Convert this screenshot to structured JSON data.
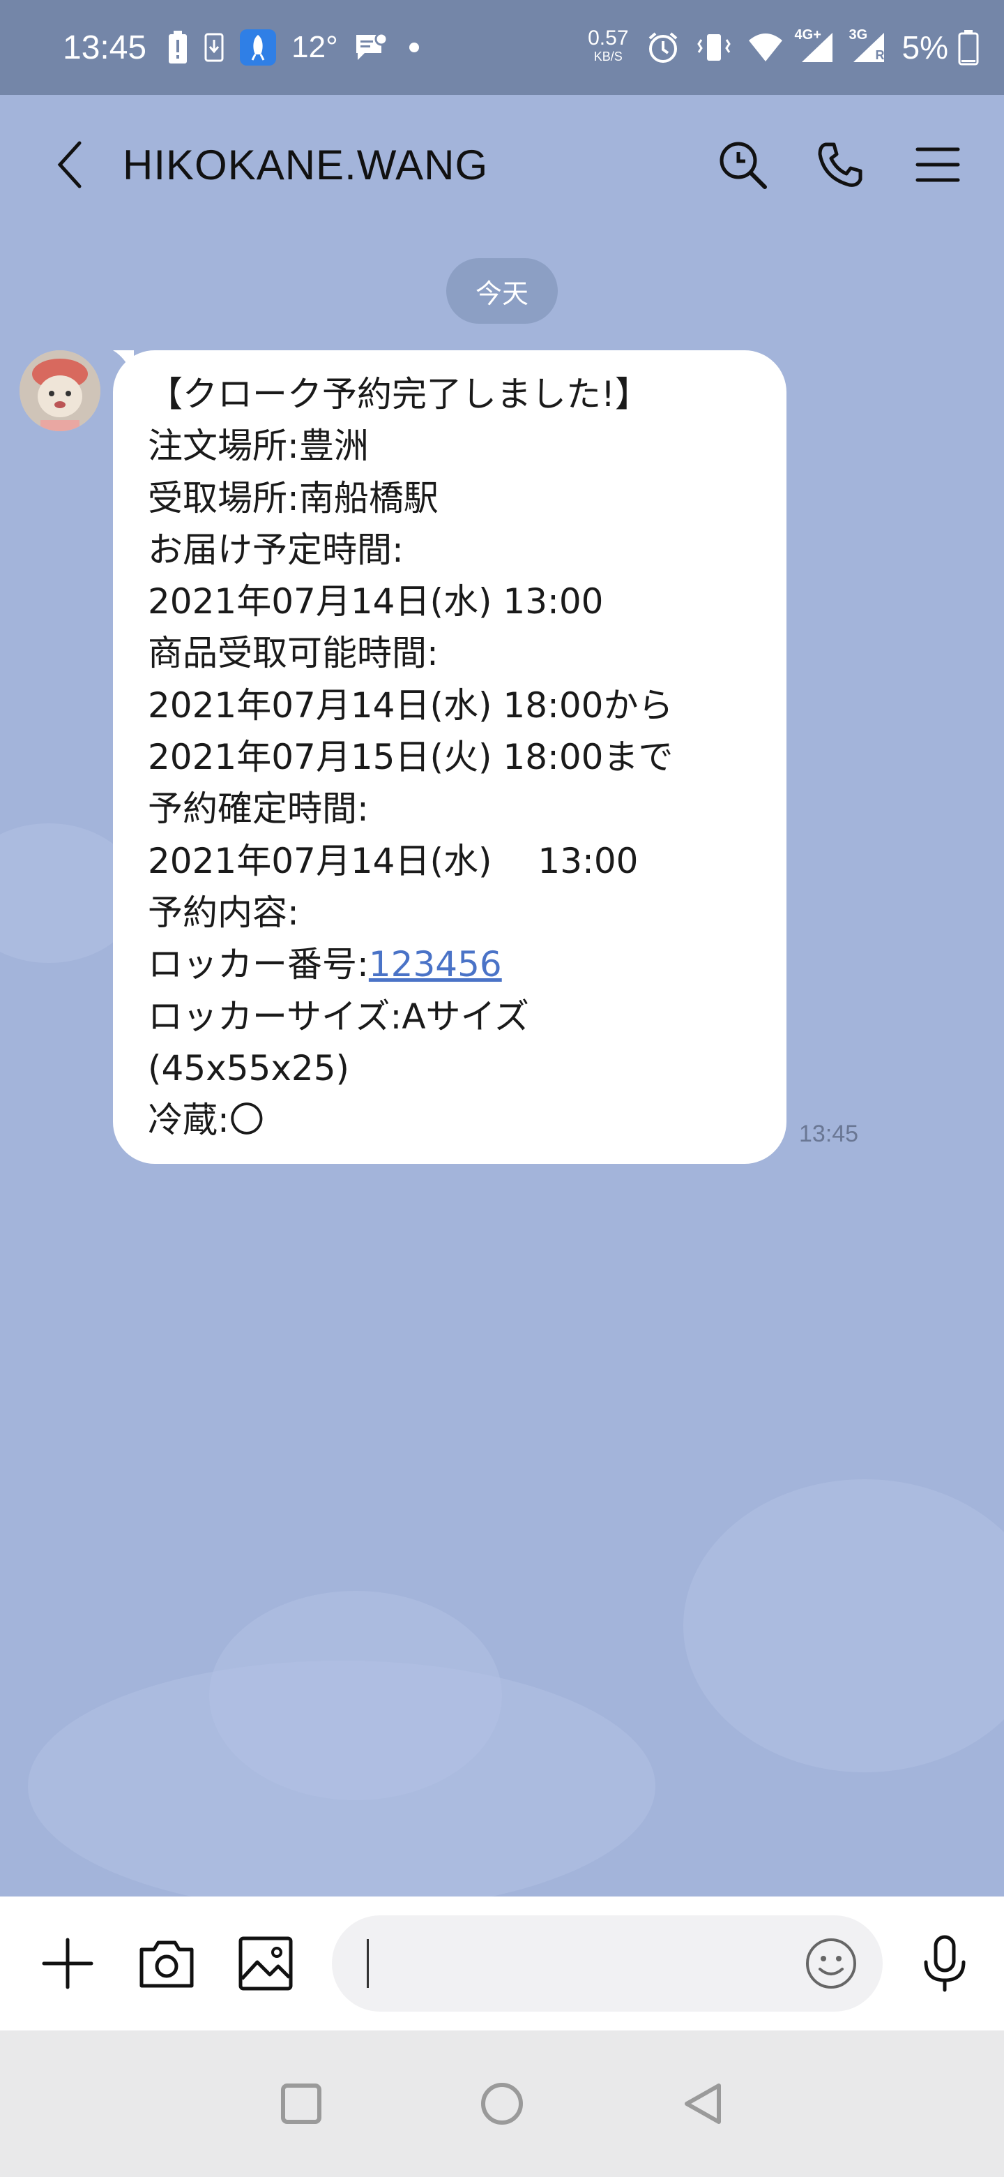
{
  "status_bar": {
    "time": "13:45",
    "temperature": "12°",
    "network_speed_value": "0.57",
    "network_speed_unit": "KB/S",
    "signal_1": "4G+",
    "signal_2": "3G",
    "signal_2_sub": "R",
    "battery": "5%"
  },
  "header": {
    "title": "HIKOKANE.WANG"
  },
  "chat": {
    "date_label": "今天",
    "message": {
      "lines": [
        "【クローク予約完了しました!】",
        "注文場所:豊洲",
        "受取場所:南船橋駅",
        "お届け予定時間:",
        "2021年07月14日(水) 13:00",
        "商品受取可能時間:",
        "2021年07月14日(水) 18:00から",
        "2021年07月15日(火) 18:00まで",
        "予約確定時間:",
        "2021年07月14日(水)　 13:00",
        "予約内容:",
        "ロッカー番号:",
        "ロッカーサイズ:Aサイズ",
        "(45x55x25)",
        "冷蔵:〇"
      ],
      "locker_number": "123456",
      "time": "13:45"
    }
  },
  "input_bar": {
    "placeholder": ""
  },
  "colors": {
    "chat_background": "#a3b4da",
    "status_bar": "#7486a8",
    "link": "#4a73c7"
  }
}
